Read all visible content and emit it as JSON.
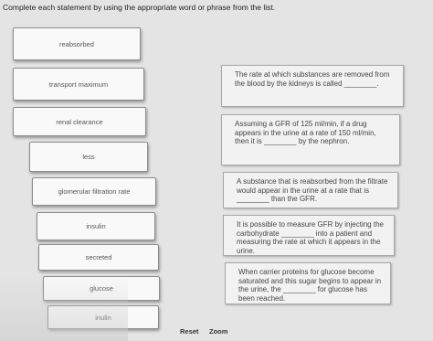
{
  "instructions": "Complete each statement by using the appropriate word or phrase from the list.",
  "word_bank": [
    "reabsorbed",
    "transport maximum",
    "renal clearance",
    "less",
    "glomerular filtration rate",
    "insulin",
    "secreted",
    "glucose",
    "inulin"
  ],
  "statements": [
    "The rate at which substances are removed from the blood by the kidneys is called ________.",
    "Assuming a GFR of 125 ml/min, if a drug appears in the urine at a rate of 150 ml/min, then it is ________ by the nephron.",
    "A substance that is reabsorbed from the filtrate would appear in the urine at a rate that is ________ than the GFR.",
    "It is possible to measure GFR by injecting the carbohydrate ________ into a patient and measuring the rate at which it appears in the urine.",
    "When carrier proteins for glucose become saturated and this sugar begins to appear in the urine, the ________ for glucose has been reached."
  ],
  "footer": {
    "reset_label": "Reset",
    "zoom_label": "Zoom"
  }
}
